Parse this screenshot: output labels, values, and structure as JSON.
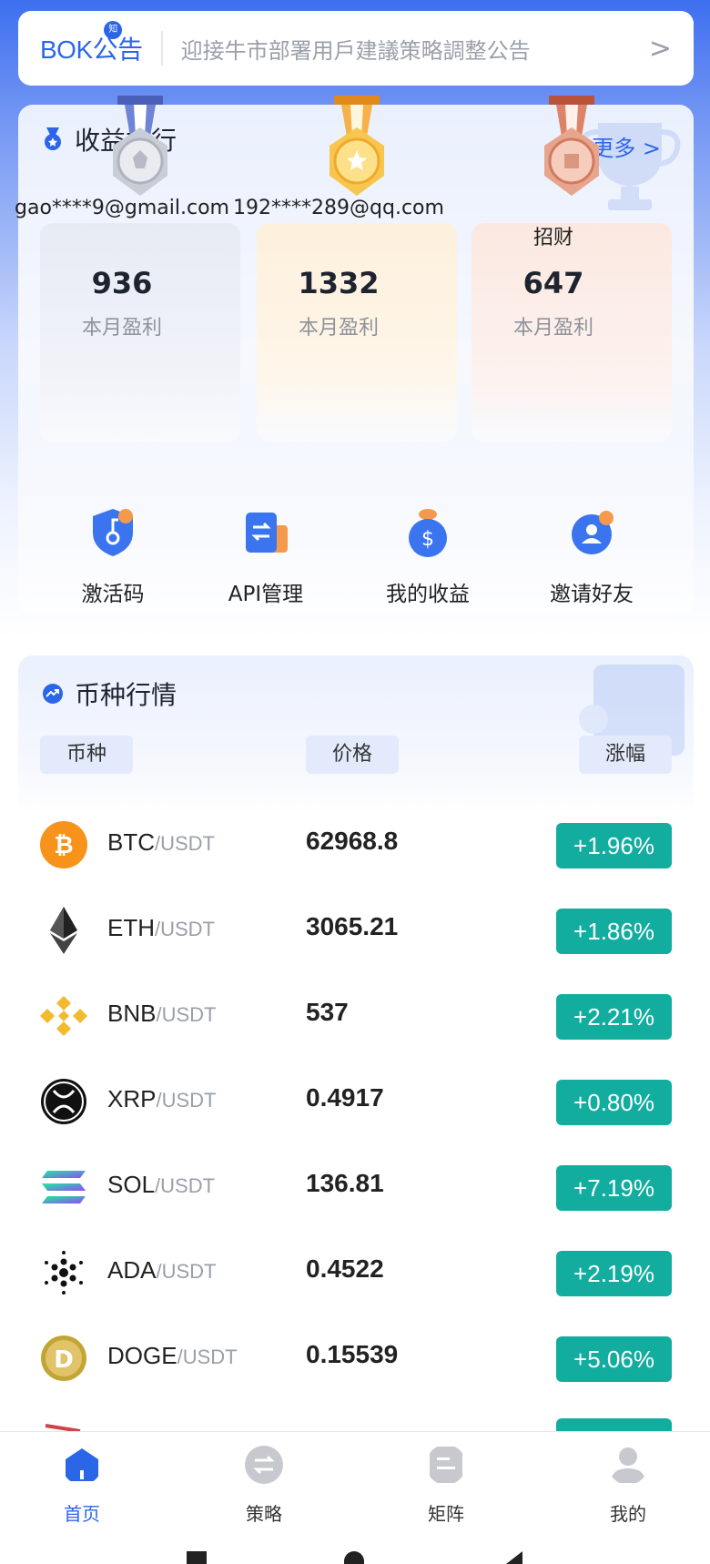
{
  "notice": {
    "logo": "BOK公告",
    "badge": "知",
    "text": "迎接牛市部署用戶建議策略調整公告",
    "arrow": ">"
  },
  "ranking": {
    "title": "收益排行",
    "more": "更多 >",
    "entries": [
      {
        "user": "gao****9@gmail.com",
        "amount": "936",
        "label": "本月盈利",
        "medal": "silver"
      },
      {
        "user": "192****289@qq.com",
        "amount": "1332",
        "label": "本月盈利",
        "medal": "gold"
      },
      {
        "user": "招财",
        "amount": "647",
        "label": "本月盈利",
        "medal": "bronze"
      }
    ]
  },
  "actions": [
    {
      "label": "激活码",
      "icon": "key-shield-icon"
    },
    {
      "label": "API管理",
      "icon": "api-exchange-icon"
    },
    {
      "label": "我的收益",
      "icon": "money-bag-icon"
    },
    {
      "label": "邀请好友",
      "icon": "invite-user-icon"
    }
  ],
  "market": {
    "title": "币种行情",
    "columns": {
      "coin": "币种",
      "price": "价格",
      "change": "涨幅"
    },
    "rows": [
      {
        "base": "BTC",
        "quote": "/USDT",
        "price": "62968.8",
        "change": "+1.96%",
        "color": "#f7931a"
      },
      {
        "base": "ETH",
        "quote": "/USDT",
        "price": "3065.21",
        "change": "+1.86%",
        "color": "#222222"
      },
      {
        "base": "BNB",
        "quote": "/USDT",
        "price": "537",
        "change": "+2.21%",
        "color": "#f3ba2f"
      },
      {
        "base": "XRP",
        "quote": "/USDT",
        "price": "0.4917",
        "change": "+0.80%",
        "color": "#111111"
      },
      {
        "base": "SOL",
        "quote": "/USDT",
        "price": "136.81",
        "change": "+7.19%",
        "color": "#9945ff"
      },
      {
        "base": "ADA",
        "quote": "/USDT",
        "price": "0.4522",
        "change": "+2.19%",
        "color": "#0033ad"
      },
      {
        "base": "DOGE",
        "quote": "/USDT",
        "price": "0.15539",
        "change": "+5.06%",
        "color": "#c2a633"
      }
    ]
  },
  "nav": [
    {
      "label": "首页",
      "active": true
    },
    {
      "label": "策略",
      "active": false
    },
    {
      "label": "矩阵",
      "active": false
    },
    {
      "label": "我的",
      "active": false
    }
  ],
  "colors": {
    "accent": "#2c66e8",
    "change_bg": "#12ad9f"
  }
}
